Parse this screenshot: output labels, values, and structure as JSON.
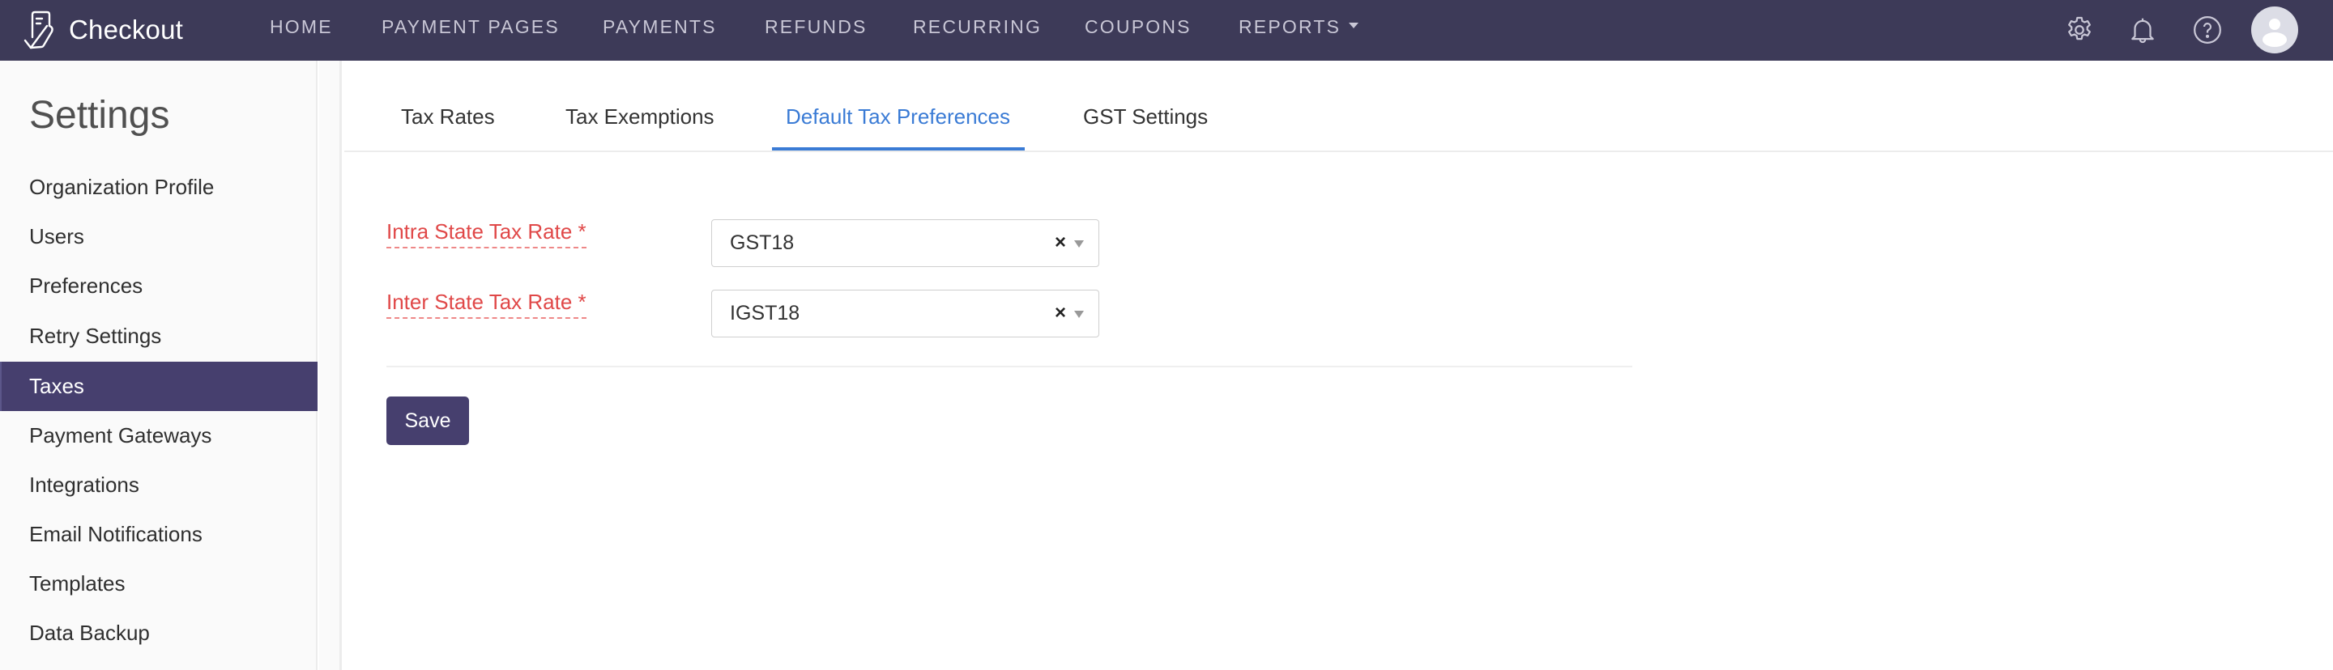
{
  "app": {
    "name": "Checkout",
    "logo_icon": "checklist-logo-icon"
  },
  "nav": {
    "items": [
      {
        "label": "HOME"
      },
      {
        "label": "PAYMENT PAGES"
      },
      {
        "label": "PAYMENTS"
      },
      {
        "label": "REFUNDS"
      },
      {
        "label": "RECURRING"
      },
      {
        "label": "COUPONS"
      },
      {
        "label": "REPORTS",
        "has_dropdown": true
      }
    ],
    "icons": [
      "gear-icon",
      "bell-icon",
      "help-icon",
      "avatar"
    ]
  },
  "sidebar": {
    "title": "Settings",
    "items": [
      {
        "label": "Organization Profile"
      },
      {
        "label": "Users"
      },
      {
        "label": "Preferences"
      },
      {
        "label": "Retry Settings"
      },
      {
        "label": "Taxes",
        "active": true
      },
      {
        "label": "Payment Gateways"
      },
      {
        "label": "Integrations"
      },
      {
        "label": "Email Notifications"
      },
      {
        "label": "Templates"
      },
      {
        "label": "Data Backup"
      }
    ]
  },
  "tabs": {
    "items": [
      {
        "label": "Tax Rates"
      },
      {
        "label": "Tax Exemptions"
      },
      {
        "label": "Default Tax Preferences",
        "active": true
      },
      {
        "label": "GST Settings"
      }
    ]
  },
  "form": {
    "fields": [
      {
        "label": "Intra State Tax Rate *",
        "value": "GST18",
        "clear_symbol": "×"
      },
      {
        "label": "Inter State Tax Rate *",
        "value": "IGST18",
        "clear_symbol": "×"
      }
    ],
    "save_label": "Save"
  },
  "colors": {
    "header_bg": "#3d3a58",
    "accent": "#463f6e",
    "active_tab": "#3a7bd5",
    "required_label": "#e04848"
  }
}
